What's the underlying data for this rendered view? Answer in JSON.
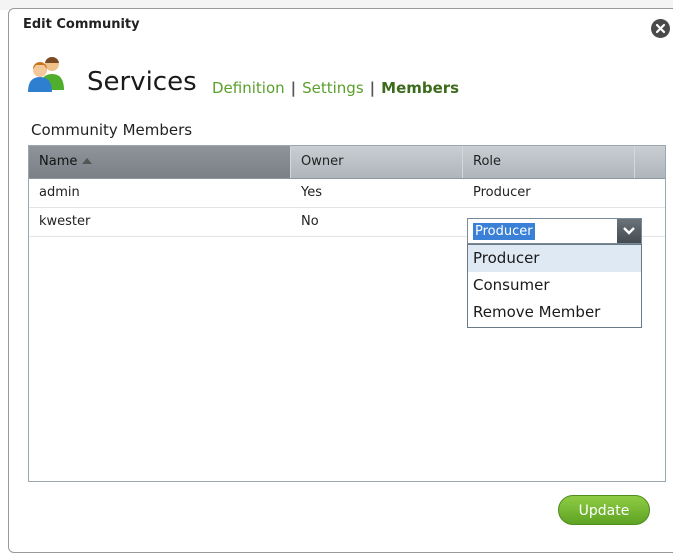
{
  "dialog": {
    "title": "Edit Community",
    "heading": "Services",
    "nav": {
      "definition": "Definition",
      "sep": "|",
      "settings": "Settings",
      "members": "Members"
    },
    "subheading": "Community Members"
  },
  "table": {
    "columns": [
      "Name",
      "Owner",
      "Role"
    ],
    "sort": {
      "column": "Name",
      "direction": "ascending"
    },
    "rows": [
      {
        "name": "admin",
        "owner": "Yes",
        "role": "Producer"
      },
      {
        "name": "kwester",
        "owner": "No",
        "role": "Producer"
      }
    ]
  },
  "role_dropdown": {
    "selected": "Producer",
    "options": [
      "Producer",
      "Consumer",
      "Remove Member"
    ]
  },
  "actions": {
    "update_label": "Update"
  },
  "colors": {
    "accent_green": "#5ea323",
    "link_green": "#5aa02c",
    "selection_blue": "#3a80d6"
  }
}
